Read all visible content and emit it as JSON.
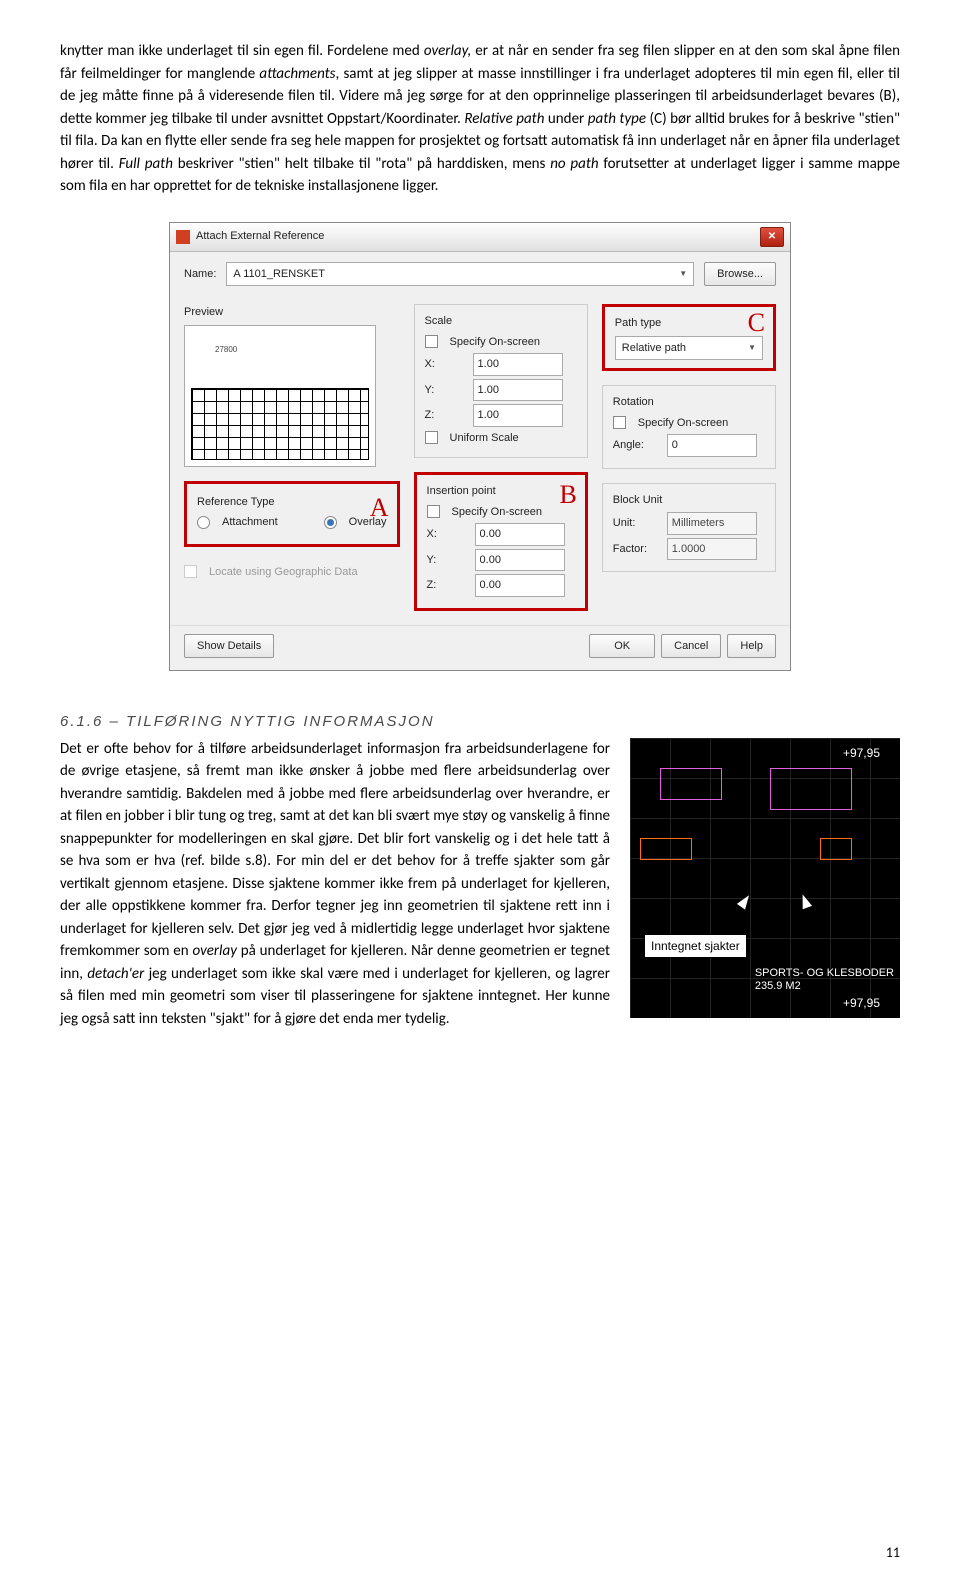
{
  "para_intro": "knytter man ikke underlaget til sin egen fil. Fordelene med ",
  "para_intro_italic1": "overlay, ",
  "para_intro2": "er at når en sender fra seg filen slipper en at den som skal åpne filen får feilmeldinger for manglende ",
  "para_intro_italic2": "attachments",
  "para_intro3": ", samt at jeg slipper at masse innstillinger i fra underlaget adopteres til min egen fil, eller til de jeg måtte finne på å videresende filen til. Videre må jeg sørge for at den opprinnelige plasseringen til arbeidsunderlaget bevares (B), dette kommer jeg tilbake til under avsnittet Oppstart/Koordinater. ",
  "para_intro_italic3": "Relative path ",
  "para_intro4": "under ",
  "para_intro_italic4": "path type ",
  "para_intro5": "(C) bør alltid brukes for å beskrive \"stien\" til fila. Da kan en flytte eller sende fra seg hele mappen for prosjektet og fortsatt automatisk få inn underlaget når en åpner fila underlaget hører til. ",
  "para_intro_italic5": "Full path ",
  "para_intro6": "beskriver \"stien\" helt tilbake til \"rota\" på harddisken, mens ",
  "para_intro_italic6": "no path ",
  "para_intro7": "forutsetter at underlaget ligger i samme mappe som fila en har opprettet for de tekniske installasjonene ligger.",
  "dialog": {
    "title": "Attach External Reference",
    "name_label": "Name:",
    "name_value": "A 1101_RENSKET",
    "browse": "Browse...",
    "preview_label": "Preview",
    "preview_dim": "27800",
    "scale_label": "Scale",
    "specify_onscreen": "Specify On-screen",
    "x_label": "X:",
    "x_val": "1.00",
    "y_label": "Y:",
    "y_val": "1.00",
    "z_label": "Z:",
    "z_val": "1.00",
    "uniform_scale": "Uniform Scale",
    "insertion_label": "Insertion point",
    "ix_val": "0.00",
    "iy_val": "0.00",
    "iz_val": "0.00",
    "reftype_label": "Reference Type",
    "attachment": "Attachment",
    "overlay": "Overlay",
    "locate_geo": "Locate using Geographic Data",
    "pathtype_label": "Path type",
    "pathtype_value": "Relative path",
    "rotation_label": "Rotation",
    "angle_label": "Angle:",
    "angle_val": "0",
    "blockunit_label": "Block Unit",
    "unit_label": "Unit:",
    "unit_val": "Millimeters",
    "factor_label": "Factor:",
    "factor_val": "1.0000",
    "show_details": "Show Details",
    "ok": "OK",
    "cancel": "Cancel",
    "help": "Help",
    "badge_a": "A",
    "badge_b": "B",
    "badge_c": "C"
  },
  "section_heading": "6.1.6 – Tilføring nyttig informasjon",
  "para2a": "Det er ofte behov for å tilføre arbeidsunderlaget informasjon fra arbeidsunderlagene for de øvrige etasjene, så fremt man ikke ønsker å jobbe med flere arbeidsunderlag over hverandre samtidig. Bakdelen med å jobbe med flere arbeidsunderlag over hverandre, er at filen en jobber i blir tung og treg, samt at det kan bli svært mye støy og vanskelig å finne snappepunkter for modelleringen en skal gjøre. Det blir fort vanskelig og i det hele tatt å se hva som er hva (ref. bilde s.8). For min del er det behov for å treffe sjakter som går vertikalt gjennom etasjene. Disse sjaktene kommer ikke frem på underlaget for kjelleren, der alle oppstikkene kommer fra. Derfor tegner jeg inn geometrien til sjaktene rett inn i underlaget for kjelleren selv. Det gjør jeg ved å midlertidig legge underlaget hvor sjaktene fremkommer som en ",
  "para2_italic1": " overlay ",
  "para2b": "på underlaget for kjelleren. Når denne geometrien er tegnet inn, ",
  "para2_italic2": "detach'er ",
  "para2c": "jeg underlaget som ikke skal være med i underlaget for kjelleren, og lagrer så filen med min geometri som viser til plasseringene for sjaktene inntegnet. Her kunne jeg også satt inn teksten \"sjakt\" for å gjøre det enda mer tydelig.",
  "cad": {
    "level1": "+97,95",
    "level2": "+97,95",
    "callout": "Inntegnet sjakter",
    "room_name": "SPORTS- OG KLESBODER",
    "room_area": "235.9 M2"
  },
  "page_number": "11"
}
